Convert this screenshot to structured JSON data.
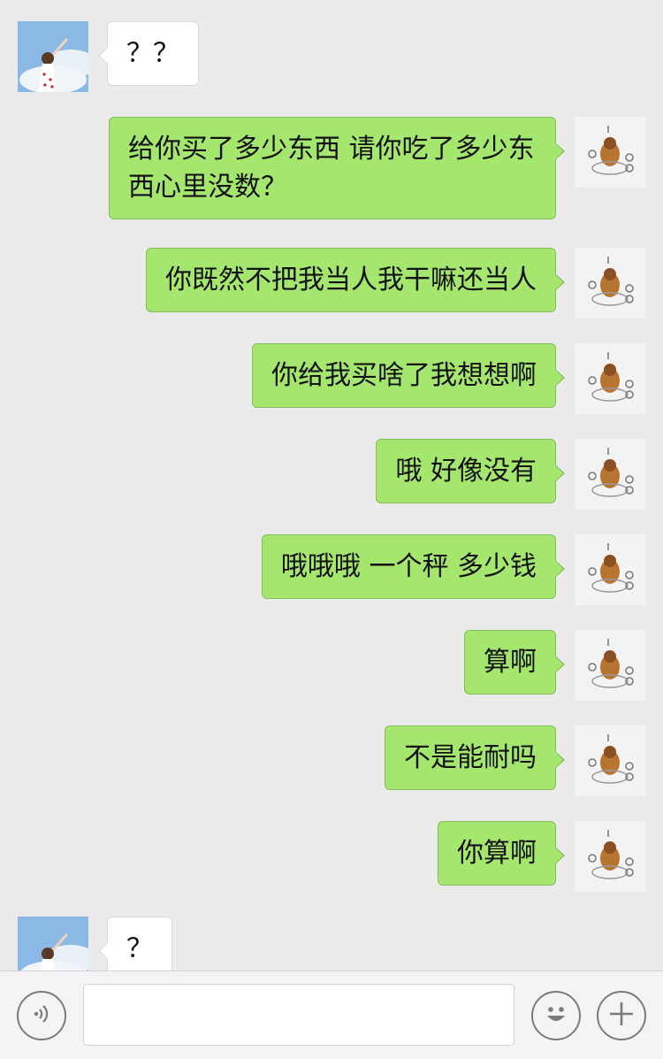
{
  "messages": [
    {
      "side": "left",
      "text": "？？"
    },
    {
      "side": "right",
      "text": "给你买了多少东西 请你吃了多少东西心里没数？"
    },
    {
      "side": "right",
      "text": "你既然不把我当人我干嘛还当人"
    },
    {
      "side": "right",
      "text": "你给我买啥了我想想啊"
    },
    {
      "side": "right",
      "text": "哦 好像没有"
    },
    {
      "side": "right",
      "text": "哦哦哦 一个秤 多少钱"
    },
    {
      "side": "right",
      "text": "算啊"
    },
    {
      "side": "right",
      "text": "不是能耐吗"
    },
    {
      "side": "right",
      "text": "你算啊"
    },
    {
      "side": "left",
      "text": "？"
    }
  ],
  "avatars": {
    "contact": "cartoon-girl-avatar",
    "self": "cat-sketch-avatar"
  },
  "toolbar": {
    "voice_icon": "voice-icon",
    "input_value": "",
    "emoji_icon": "emoji-icon",
    "plus_icon": "plus-icon"
  },
  "colors": {
    "background": "#ebebeb",
    "my_bubble": "#a5e66f",
    "their_bubble": "#ffffff"
  }
}
